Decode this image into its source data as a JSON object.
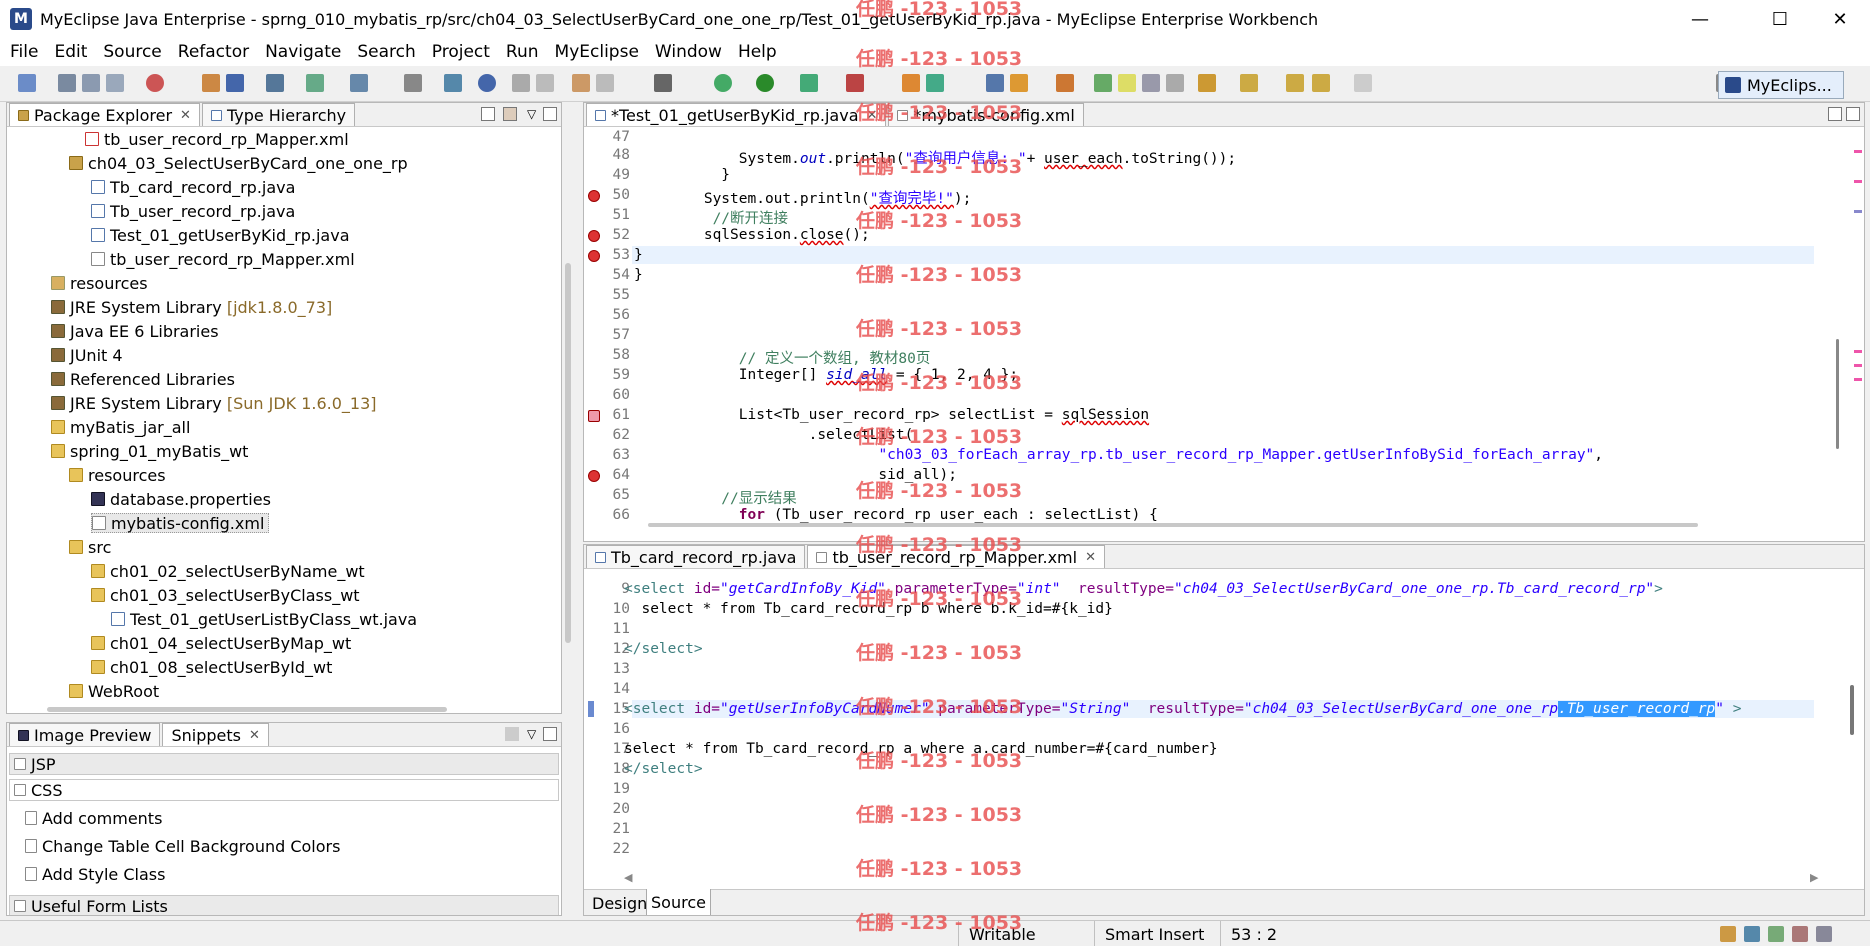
{
  "window": {
    "title": "MyEclipse Java Enterprise - sprng_010_mybatis_rp/src/ch04_03_SelectUserByCard_one_one_rp/Test_01_getUserByKid_rp.java - MyEclipse Enterprise Workbench",
    "minimize": "—",
    "maximize": "☐",
    "close": "✕"
  },
  "menu": [
    "File",
    "Edit",
    "Source",
    "Refactor",
    "Navigate",
    "Search",
    "Project",
    "Run",
    "MyEclipse",
    "Window",
    "Help"
  ],
  "toolbar": {
    "perspective": "MyEclips..."
  },
  "package_explorer": {
    "tabs": [
      "Package Explorer",
      "Type Hierarchy"
    ],
    "items": [
      {
        "label": "tb_user_record_rp_Mapper.xml",
        "icon": "xml-error-icon"
      },
      {
        "label": "ch04_03_SelectUserByCard_one_one_rp",
        "icon": "package-icon"
      },
      {
        "label": "Tb_card_record_rp.java",
        "icon": "java-file-icon"
      },
      {
        "label": "Tb_user_record_rp.java",
        "icon": "java-file-icon"
      },
      {
        "label": "Test_01_getUserByKid_rp.java",
        "icon": "java-file-icon"
      },
      {
        "label": "tb_user_record_rp_Mapper.xml",
        "icon": "xml-file-icon"
      },
      {
        "label": "resources",
        "icon": "resource-folder-icon"
      },
      {
        "label": "JRE System Library",
        "suffix": "[jdk1.8.0_73]",
        "icon": "library-icon"
      },
      {
        "label": "Java EE 6 Libraries",
        "icon": "library-icon"
      },
      {
        "label": "JUnit 4",
        "icon": "library-icon"
      },
      {
        "label": "Referenced Libraries",
        "icon": "library-icon"
      },
      {
        "label": "JRE System Library",
        "suffix": "[Sun JDK 1.6.0_13]",
        "icon": "library-icon"
      },
      {
        "label": "myBatis_jar_all",
        "icon": "folder-icon"
      },
      {
        "label": "spring_01_myBatis_wt",
        "icon": "project-icon"
      },
      {
        "label": "resources",
        "icon": "folder-icon"
      },
      {
        "label": "database.properties",
        "icon": "properties-file-icon"
      },
      {
        "label": "mybatis-config.xml",
        "icon": "xml-file-icon"
      },
      {
        "label": "src",
        "icon": "folder-icon"
      },
      {
        "label": "ch01_02_selectUserByName_wt",
        "icon": "package-icon"
      },
      {
        "label": "ch01_03_selectUserByClass_wt",
        "icon": "package-icon"
      },
      {
        "label": "Test_01_getUserListByClass_wt.java",
        "icon": "java-file-icon"
      },
      {
        "label": "ch01_04_selectUserByMap_wt",
        "icon": "package-icon"
      },
      {
        "label": "ch01_08_selectUserById_wt",
        "icon": "package-icon"
      },
      {
        "label": "WebRoot",
        "icon": "folder-icon"
      }
    ]
  },
  "snippets": {
    "tabs": [
      "Image Preview",
      "Snippets"
    ],
    "categories": [
      "JSP",
      "CSS"
    ],
    "items": [
      "Add comments",
      "Change Table Cell Background Colors",
      "Add Style Class"
    ],
    "category_bottom": "Useful Form Lists"
  },
  "editor_top": {
    "tabs": [
      "*Test_01_getUserByKid_rp.java",
      "*mybatis-config.xml"
    ],
    "line_numbers": [
      "47",
      "48",
      "49",
      "50",
      "51",
      "52",
      "53",
      "54",
      "55",
      "56",
      "57",
      "58",
      "59",
      "60",
      "61",
      "62",
      "63",
      "64",
      "65",
      "66"
    ],
    "lines": {
      "l48a": "            System.",
      "l48b": "out",
      "l48c": ".println(",
      "l48d": "\"查询用户信息: \"",
      "l48e": "+ ",
      "l48f": "user_each",
      "l48g": ".toString());",
      "l49": "          }",
      "l50a": "        System.out.println(",
      "l50b": "\"查询完毕!\"",
      "l50c": ");",
      "l51": "         //断开连接",
      "l52a": "        sqlSession.",
      "l52b": "close",
      "l52c": "();",
      "l53": "}",
      "l54": "}",
      "l58": "            // 定义一个数组, 教材80页",
      "l59a": "            Integer[] ",
      "l59b": "sid_all",
      "l59c": " = { 1, 2, 4 };",
      "l61a": "            List<Tb_user_record_rp> selectList = ",
      "l61b": "sqlSession",
      "l62": "                    .selectList(",
      "l63a": "                            ",
      "l63b": "\"ch03_03_forEach_array_rp.tb_user_record_rp_Mapper.getUserInfoBySid_forEach_array\"",
      "l63c": ",",
      "l64": "                            sid_all);",
      "l65": "          //显示结果",
      "l66a": "            ",
      "l66b": "for",
      "l66c": " (Tb_user_record_rp user_each : selectList) {"
    }
  },
  "editor_bottom": {
    "tabs": [
      "Tb_card_record_rp.java",
      "tb_user_record_rp_Mapper.xml"
    ],
    "line_numbers": [
      "9",
      "10",
      "11",
      "12",
      "13",
      "14",
      "15",
      "16",
      "17",
      "18",
      "19",
      "20",
      "21",
      "22"
    ],
    "lines": {
      "l9a": "<select ",
      "l9b": "id=",
      "l9c": "\"getCardInfoBy_Kid\"",
      "l9d": " parameterType=",
      "l9e": "\"int\"",
      "l9f": "  resultType=",
      "l9g": "\"ch04_03_SelectUserByCard_one_one_rp.Tb_card_record_rp\"",
      "l9h": ">",
      "l10": "  select * from Tb_card_record_rp b where b.k_id=#{k_id}",
      "l12": "</select>",
      "l15a": "<select ",
      "l15b": "id=",
      "l15c": "\"getUserInfoByCardNumer\"",
      "l15d": " parameterType=",
      "l15e": "\"String\"",
      "l15f": "  resultType=",
      "l15g": "\"ch04_03_SelectUserByCard_one_one_rp",
      "l15h": ".Tb_user_record_rp",
      "l15i": "\"",
      "l15j": " >",
      "l17": "select * from Tb_card_record_rp a where a.card_number=#{card_number}",
      "l18": "</select>"
    },
    "mode_tabs": [
      "Design",
      "Source"
    ]
  },
  "status": {
    "writable": "Writable",
    "insert": "Smart Insert",
    "position": "53 : 2"
  },
  "watermark": "任鹏 -123 - 1053"
}
